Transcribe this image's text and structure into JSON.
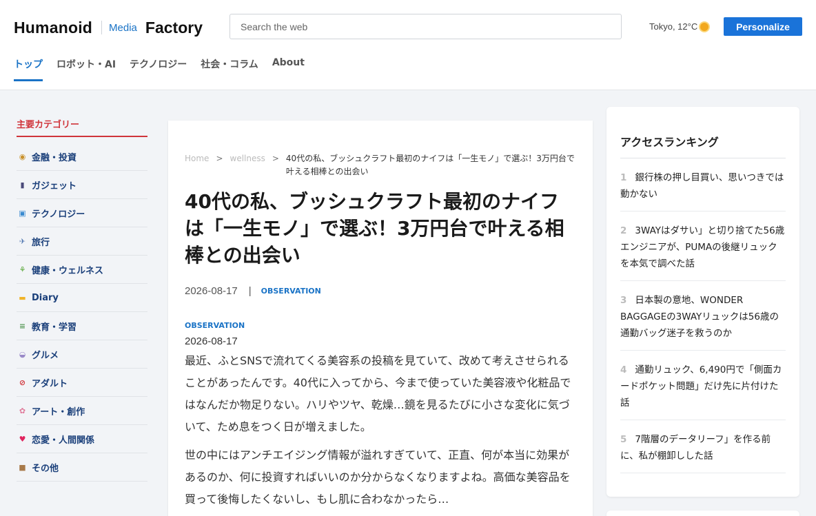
{
  "header": {
    "logo_humanoid": "Humanoid",
    "logo_media": "Media",
    "logo_factory": "Factory",
    "search_placeholder": "Search the web",
    "weather": "Tokyo, 12°C",
    "personalize": "Personalize"
  },
  "nav": {
    "items": [
      {
        "label": "トップ"
      },
      {
        "label": "ロボット・AI"
      },
      {
        "label": "テクノロジー"
      },
      {
        "label": "社会・コラム"
      },
      {
        "label": "About"
      }
    ]
  },
  "sidebar": {
    "title": "主要カテゴリー",
    "items": [
      {
        "label": "金融・投資",
        "icon": "money-bag-icon"
      },
      {
        "label": "ガジェット",
        "icon": "phone-icon"
      },
      {
        "label": "テクノロジー",
        "icon": "computer-icon"
      },
      {
        "label": "旅行",
        "icon": "airplane-icon"
      },
      {
        "label": "健康・ウェルネス",
        "icon": "herb-icon"
      },
      {
        "label": "Diary",
        "icon": "folder-icon"
      },
      {
        "label": "教育・学習",
        "icon": "books-icon"
      },
      {
        "label": "グルメ",
        "icon": "food-icon"
      },
      {
        "label": "アダルト",
        "icon": "no-under-18-icon"
      },
      {
        "label": "アート・創作",
        "icon": "palette-icon"
      },
      {
        "label": "恋愛・人間関係",
        "icon": "heart-icon"
      },
      {
        "label": "その他",
        "icon": "box-icon"
      }
    ]
  },
  "article": {
    "breadcrumb": {
      "home": "Home",
      "sep": ">",
      "category": "wellness",
      "current": "40代の私、ブッシュクラフト最初のナイフは「一生モノ」で選ぶ！3万円台で叶える相棒との出会い"
    },
    "title": "40代の私、ブッシュクラフト最初のナイフは「一生モノ」で選ぶ！3万円台で叶える相棒との出会い",
    "date": "2026-08-17",
    "meta_sep": "|",
    "tag": "OBSERVATION",
    "tag2": "OBSERVATION",
    "date2": "2026-08-17",
    "paragraphs": [
      "最近、ふとSNSで流れてくる美容系の投稿を見ていて、改めて考えさせられることがあったんです。40代に入ってから、今まで使っていた美容液や化粧品ではなんだか物足りない。ハリやツヤ、乾燥…鏡を見るたびに小さな変化に気づいて、ため息をつく日が増えました。",
      "世の中にはアンチエイジング情報が溢れすぎていて、正直、何が本当に効果があるのか、何に投資すればいいのか分からなくなりますよね。高価な美容品を買って後悔したくないし、もし肌に合わなかったら…"
    ]
  },
  "ranking": {
    "title": "アクセスランキング",
    "items": [
      {
        "num": "1",
        "text": "銀行株の押し目買い、思いつきでは動かない"
      },
      {
        "num": "2",
        "text": "3WAYはダサい」と切り捨てた56歳エンジニアが、PUMAの後継リュックを本気で調べた話"
      },
      {
        "num": "3",
        "text": "日本製の意地、WONDER BAGGAGEの3WAYリュックは56歳の通勤バッグ迷子を救うのか"
      },
      {
        "num": "4",
        "text": "通勤リュック、6,490円で「側面カードポケット問題」だけ先に片付けた話"
      },
      {
        "num": "5",
        "text": "7階層のデータリーフ」を作る前に、私が棚卸しした話"
      }
    ]
  },
  "colors": {
    "accent": "#1a73c6",
    "category_title": "#d0343a",
    "category_link": "#1a3f7a"
  }
}
